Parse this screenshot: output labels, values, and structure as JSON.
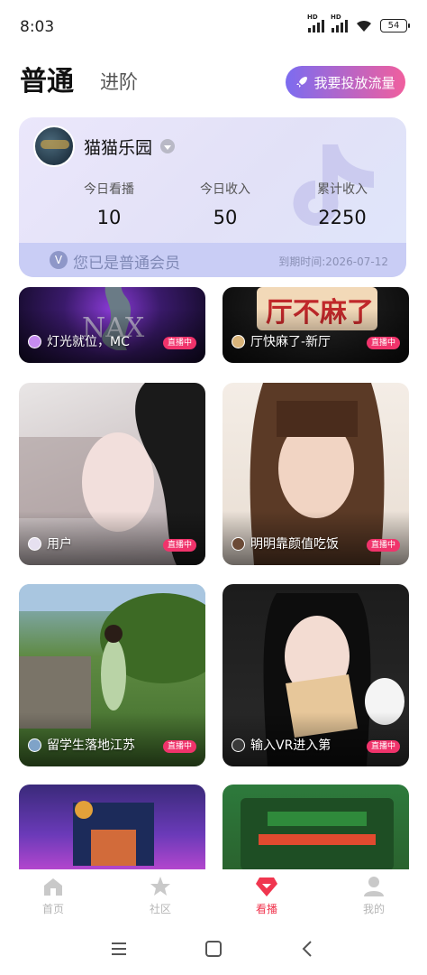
{
  "status_bar": {
    "time": "8:03",
    "battery": "54",
    "signal_label_1": "HD",
    "signal_label_2": "HD"
  },
  "header": {
    "tab_normal": "普通",
    "tab_advanced": "进阶",
    "promo_button": "我要投放流量"
  },
  "member_card": {
    "room_name": "猫猫乐园",
    "stats": [
      {
        "label": "今日看播",
        "value": "10"
      },
      {
        "label": "今日收入",
        "value": "50"
      },
      {
        "label": "累计收入",
        "value": "2250"
      }
    ],
    "membership_text": "您已是普通会员",
    "membership_icon": "V",
    "expire_text": "到期时间:2026-07-12"
  },
  "live_badge": "直播中",
  "streams": [
    {
      "title": "灯光就位，MC",
      "live_badge": "直播中"
    },
    {
      "title": "厅快麻了-新厅",
      "live_badge": "直播中"
    },
    {
      "title": "用户",
      "live_badge": "直播中"
    },
    {
      "title": "明明靠颜值吃饭",
      "live_badge": "直播中"
    },
    {
      "title": "留学生落地江苏",
      "live_badge": "直播中"
    },
    {
      "title": "输入VR进入第",
      "live_badge": "直播中"
    }
  ],
  "bottom_nav": [
    {
      "label": "首页",
      "icon": "home-icon"
    },
    {
      "label": "社区",
      "icon": "star-icon"
    },
    {
      "label": "看播",
      "icon": "gem-icon",
      "active": true
    },
    {
      "label": "我的",
      "icon": "person-icon"
    }
  ],
  "colors": {
    "accent": "#f0364f",
    "promo_gradient_start": "#7c6cf0",
    "promo_gradient_end": "#f05f9e",
    "live_badge": "#f0336b"
  }
}
